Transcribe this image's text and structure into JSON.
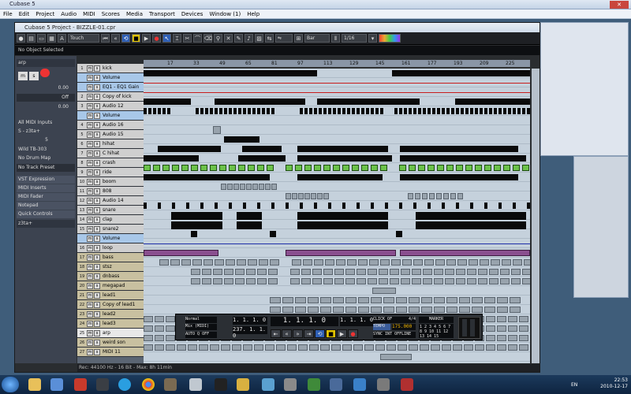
{
  "app": {
    "title": "Cubase 5"
  },
  "menu": [
    "File",
    "Edit",
    "Project",
    "Audio",
    "MIDI",
    "Scores",
    "Media",
    "Transport",
    "Devices",
    "Window (1)",
    "Help"
  ],
  "project": {
    "title": "Cubase 5 Project - BIZZLE-01.cpr",
    "automation_mode": "Touch",
    "info_line": "No Object Selected",
    "snap_type": "Bar",
    "quantize": "1/16",
    "status": "Rec: 44100 Hz - 16 Bit - Max: 8h 11min"
  },
  "inspector": {
    "track_name": "arp",
    "volume": "0.00",
    "pan": "Off",
    "delay": "0.00",
    "input": "All MIDI Inputs",
    "output": "S - z3ta+",
    "channel": "5",
    "device": "Wild TB-303",
    "drum_map": "No Drum Map",
    "track_preset": "No Track Preset",
    "sections": [
      "VST Expression",
      "MIDI Inserts",
      "MIDI Fader",
      "Notepad",
      "Quick Controls"
    ],
    "instrument": "z3ta+"
  },
  "ruler": [
    "17",
    "33",
    "49",
    "65",
    "81",
    "97",
    "113",
    "129",
    "145",
    "161",
    "177",
    "193",
    "209",
    "225"
  ],
  "tracks": [
    {
      "n": "1",
      "name": "kick",
      "color": "#cfcfcf"
    },
    {
      "n": "",
      "name": "Volume",
      "color": "#a8c7e8"
    },
    {
      "n": "",
      "name": "EQ1 - EQ1 Gain",
      "color": "#a8c7e8"
    },
    {
      "n": "2",
      "name": "Copy of kick",
      "color": "#cfcfcf"
    },
    {
      "n": "3",
      "name": "Audio 12",
      "color": "#cfcfcf"
    },
    {
      "n": "",
      "name": "Volume",
      "color": "#a8c7e8"
    },
    {
      "n": "4",
      "name": "Audio 16",
      "color": "#cfcfcf"
    },
    {
      "n": "5",
      "name": "Audio 15",
      "color": "#cfcfcf"
    },
    {
      "n": "6",
      "name": "hihat",
      "color": "#cfcfcf"
    },
    {
      "n": "7",
      "name": "C hihat",
      "color": "#cfcfcf"
    },
    {
      "n": "8",
      "name": "crash",
      "color": "#cfcfcf"
    },
    {
      "n": "9",
      "name": "ride",
      "color": "#cfcfcf"
    },
    {
      "n": "10",
      "name": "boom",
      "color": "#cfcfcf"
    },
    {
      "n": "11",
      "name": "808",
      "color": "#cfcfcf"
    },
    {
      "n": "12",
      "name": "Audio 14",
      "color": "#cfcfcf"
    },
    {
      "n": "13",
      "name": "snare",
      "color": "#cfcfcf"
    },
    {
      "n": "14",
      "name": "clap",
      "color": "#cfcfcf"
    },
    {
      "n": "15",
      "name": "snare2",
      "color": "#cfcfcf"
    },
    {
      "n": "",
      "name": "Volume",
      "color": "#a8c7e8"
    },
    {
      "n": "16",
      "name": "loop",
      "color": "#cfcfcf"
    },
    {
      "n": "17",
      "name": "bass",
      "color": "#c8c0a0"
    },
    {
      "n": "18",
      "name": "stsz",
      "color": "#c8c0a0"
    },
    {
      "n": "19",
      "name": "dnbass",
      "color": "#c8c0a0"
    },
    {
      "n": "20",
      "name": "megapad",
      "color": "#c8c0a0"
    },
    {
      "n": "21",
      "name": "lead1",
      "color": "#c8c0a0"
    },
    {
      "n": "22",
      "name": "Copy of lead1",
      "color": "#c8c0a0"
    },
    {
      "n": "23",
      "name": "lead2",
      "color": "#c8c0a0"
    },
    {
      "n": "24",
      "name": "lead3",
      "color": "#c8c0a0"
    },
    {
      "n": "25",
      "name": "arp",
      "color": "#e8e8e8"
    },
    {
      "n": "26",
      "name": "weird son",
      "color": "#c8c0a0"
    },
    {
      "n": "27",
      "name": "MIDI 11",
      "color": "#c8c0a0"
    }
  ],
  "transport": {
    "mode": "Normal",
    "mix": "Mix (MIDI)",
    "auto_q": "AUTO Q  OFF",
    "left_locator": "1. 1. 1. 0",
    "right_locator": "237. 1. 1. 0",
    "position": "1. 1. 1. 0",
    "position2": "1. 1. 1. 0",
    "click": "CLICK OFF",
    "tempo_label": "TEMPO",
    "tempo": "175.000",
    "signature": "4/4",
    "sync": "SYNC  INT  OFFLINE",
    "marker_label": "MARKER"
  },
  "taskbar": {
    "time": "22:53",
    "date": "2010-12-17",
    "lang": "EN"
  }
}
